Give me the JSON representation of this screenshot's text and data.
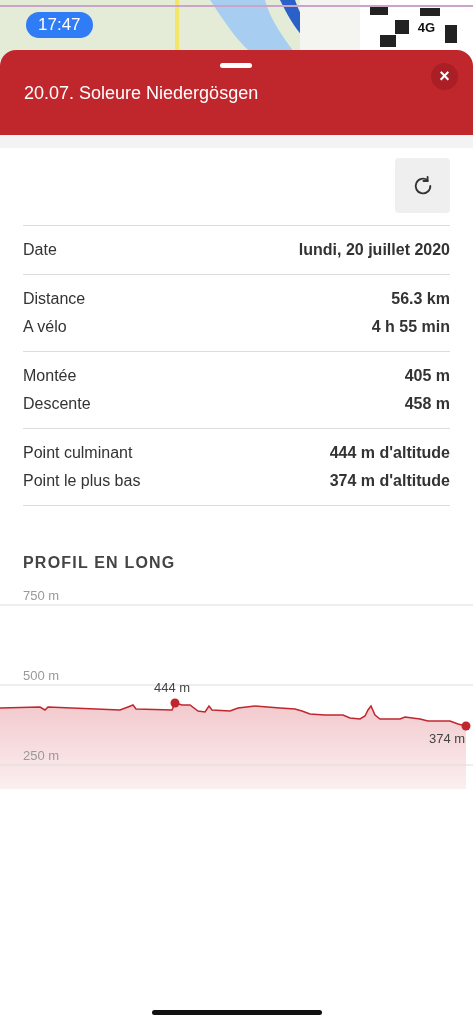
{
  "status_bar": {
    "time": "17:47",
    "network": "4G"
  },
  "sheet": {
    "title": "20.07. Soleure Niedergösgen",
    "close": "×"
  },
  "groups": [
    {
      "rows": [
        {
          "label": "Date",
          "value": "lundi, 20 juillet 2020"
        }
      ]
    },
    {
      "rows": [
        {
          "label": "Distance",
          "value": "56.3 km"
        },
        {
          "label": "A vélo",
          "value": "4 h 55 min"
        }
      ]
    },
    {
      "rows": [
        {
          "label": "Montée",
          "value": "405 m"
        },
        {
          "label": "Descente",
          "value": "458 m"
        }
      ]
    },
    {
      "rows": [
        {
          "label": "Point culminant",
          "value": "444 m d'altitude"
        },
        {
          "label": "Point le plus bas",
          "value": "374 m d'altitude"
        }
      ]
    }
  ],
  "profile": {
    "heading": "PROFIL EN LONG",
    "gridlines": [
      "750 m",
      "500 m",
      "250 m"
    ],
    "markers": [
      {
        "kind": "high",
        "label": "444 m"
      },
      {
        "kind": "low",
        "label": "374 m"
      }
    ]
  }
}
